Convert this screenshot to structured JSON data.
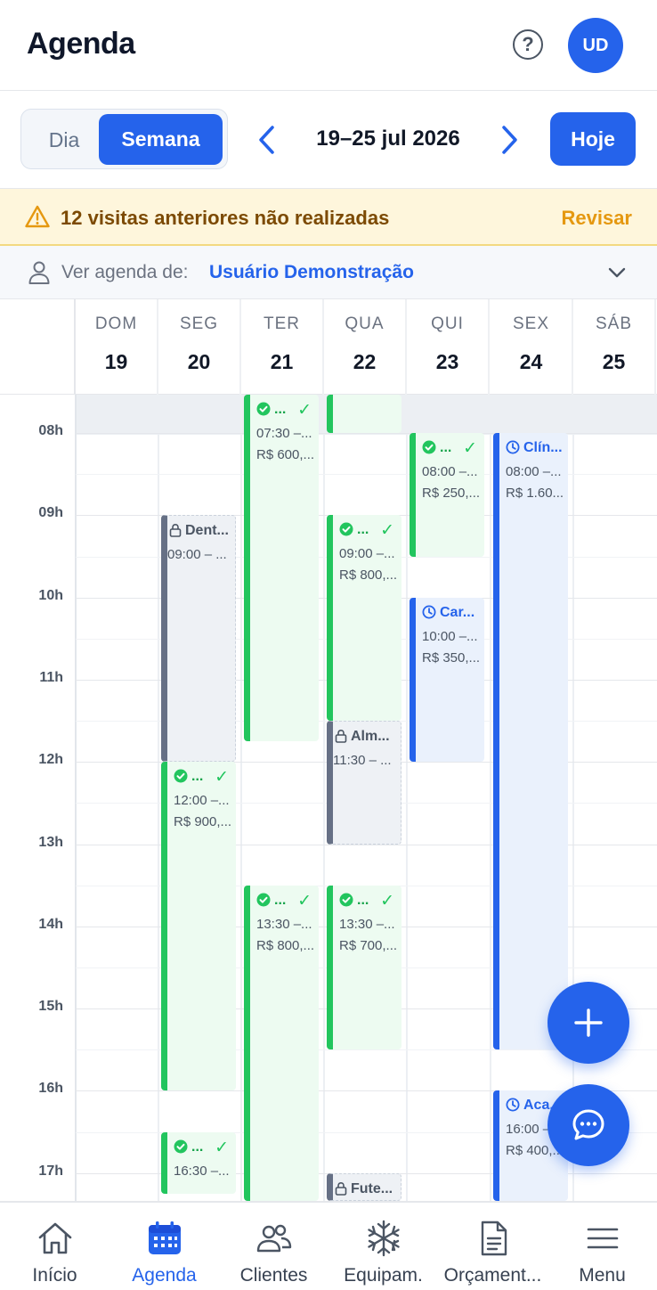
{
  "header": {
    "title": "Agenda",
    "help_label": "?",
    "avatar_initials": "UD"
  },
  "controls": {
    "view_day": "Dia",
    "view_week": "Semana",
    "range": "19–25 jul 2026",
    "today": "Hoje"
  },
  "alert": {
    "message": "12 visitas anteriores não realizadas",
    "action": "Revisar"
  },
  "user_selector": {
    "label": "Ver agenda de:",
    "value": "Usuário Demonstração"
  },
  "days": [
    {
      "name": "DOM",
      "num": "19"
    },
    {
      "name": "SEG",
      "num": "20"
    },
    {
      "name": "TER",
      "num": "21"
    },
    {
      "name": "QUA",
      "num": "22"
    },
    {
      "name": "QUI",
      "num": "23"
    },
    {
      "name": "SEX",
      "num": "24"
    },
    {
      "name": "SÁB",
      "num": "25"
    }
  ],
  "hours": [
    "08h",
    "09h",
    "10h",
    "11h",
    "12h",
    "13h",
    "14h",
    "15h",
    "16h",
    "17h"
  ],
  "events": [
    {
      "day": 2,
      "start": "07:30",
      "end": "11:45",
      "style": "green",
      "icon": "check-circle-icon",
      "title": "...",
      "done": true,
      "time": "07:30 –...",
      "price": "R$ 600,..."
    },
    {
      "day": 3,
      "start": "07:30",
      "end": "08:00",
      "style": "green",
      "icon": "",
      "title": "",
      "done": false,
      "time": "",
      "price": ""
    },
    {
      "day": 4,
      "start": "08:00",
      "end": "09:30",
      "style": "green",
      "icon": "check-circle-icon",
      "title": "...",
      "done": true,
      "time": "08:00 –...",
      "price": "R$ 250,..."
    },
    {
      "day": 5,
      "start": "08:00",
      "end": "15:30",
      "style": "blue",
      "icon": "clock-icon",
      "title": "Clín...",
      "done": false,
      "time": "08:00 –...",
      "price": "R$ 1.60..."
    },
    {
      "day": 1,
      "start": "09:00",
      "end": "12:00",
      "style": "gray",
      "icon": "lock-icon",
      "title": "Dent...",
      "done": false,
      "time": "09:00 – ...",
      "price": ""
    },
    {
      "day": 3,
      "start": "09:00",
      "end": "11:30",
      "style": "green",
      "icon": "check-circle-icon",
      "title": "...",
      "done": true,
      "time": "09:00 –...",
      "price": "R$ 800,..."
    },
    {
      "day": 4,
      "start": "10:00",
      "end": "12:00",
      "style": "blue",
      "icon": "clock-icon",
      "title": "Car...",
      "done": false,
      "time": "10:00 –...",
      "price": "R$ 350,..."
    },
    {
      "day": 3,
      "start": "11:30",
      "end": "13:00",
      "style": "gray",
      "icon": "lock-icon",
      "title": "Alm...",
      "done": false,
      "time": "11:30 – ...",
      "price": ""
    },
    {
      "day": 1,
      "start": "12:00",
      "end": "16:00",
      "style": "green",
      "icon": "check-circle-icon",
      "title": "...",
      "done": true,
      "time": "12:00 –...",
      "price": "R$ 900,..."
    },
    {
      "day": 2,
      "start": "13:30",
      "end": "17:40",
      "style": "green",
      "icon": "check-circle-icon",
      "title": "...",
      "done": true,
      "time": "13:30 –...",
      "price": "R$ 800,..."
    },
    {
      "day": 3,
      "start": "13:30",
      "end": "15:30",
      "style": "green",
      "icon": "check-circle-icon",
      "title": "...",
      "done": true,
      "time": "13:30 –...",
      "price": "R$ 700,..."
    },
    {
      "day": 5,
      "start": "16:00",
      "end": "17:40",
      "style": "blue",
      "icon": "clock-icon",
      "title": "Aca...",
      "done": false,
      "time": "16:00 –...",
      "price": "R$ 400,..."
    },
    {
      "day": 1,
      "start": "16:30",
      "end": "17:15",
      "style": "green",
      "icon": "check-circle-icon",
      "title": "...",
      "done": true,
      "time": "16:30 –...",
      "price": ""
    },
    {
      "day": 3,
      "start": "17:00",
      "end": "17:40",
      "style": "gray",
      "icon": "lock-icon",
      "title": "Fute...",
      "done": false,
      "time": "",
      "price": ""
    }
  ],
  "check_mark": "✓",
  "fab": {
    "add_icon": "plus-icon",
    "chat_icon": "chat-icon"
  },
  "bottom_nav": [
    {
      "label": "Início",
      "icon": "home-icon",
      "active": false
    },
    {
      "label": "Agenda",
      "icon": "calendar-icon",
      "active": true
    },
    {
      "label": "Clientes",
      "icon": "users-icon",
      "active": false
    },
    {
      "label": "Equipam.",
      "icon": "snowflake-icon",
      "active": false
    },
    {
      "label": "Orçament...",
      "icon": "document-icon",
      "active": false
    },
    {
      "label": "Menu",
      "icon": "menu-icon",
      "active": false
    }
  ],
  "colors": {
    "primary": "#2563eb",
    "success": "#22c55e",
    "warning_text": "#7c4a03",
    "warning_action": "#e59810",
    "blocked": "#667085"
  }
}
